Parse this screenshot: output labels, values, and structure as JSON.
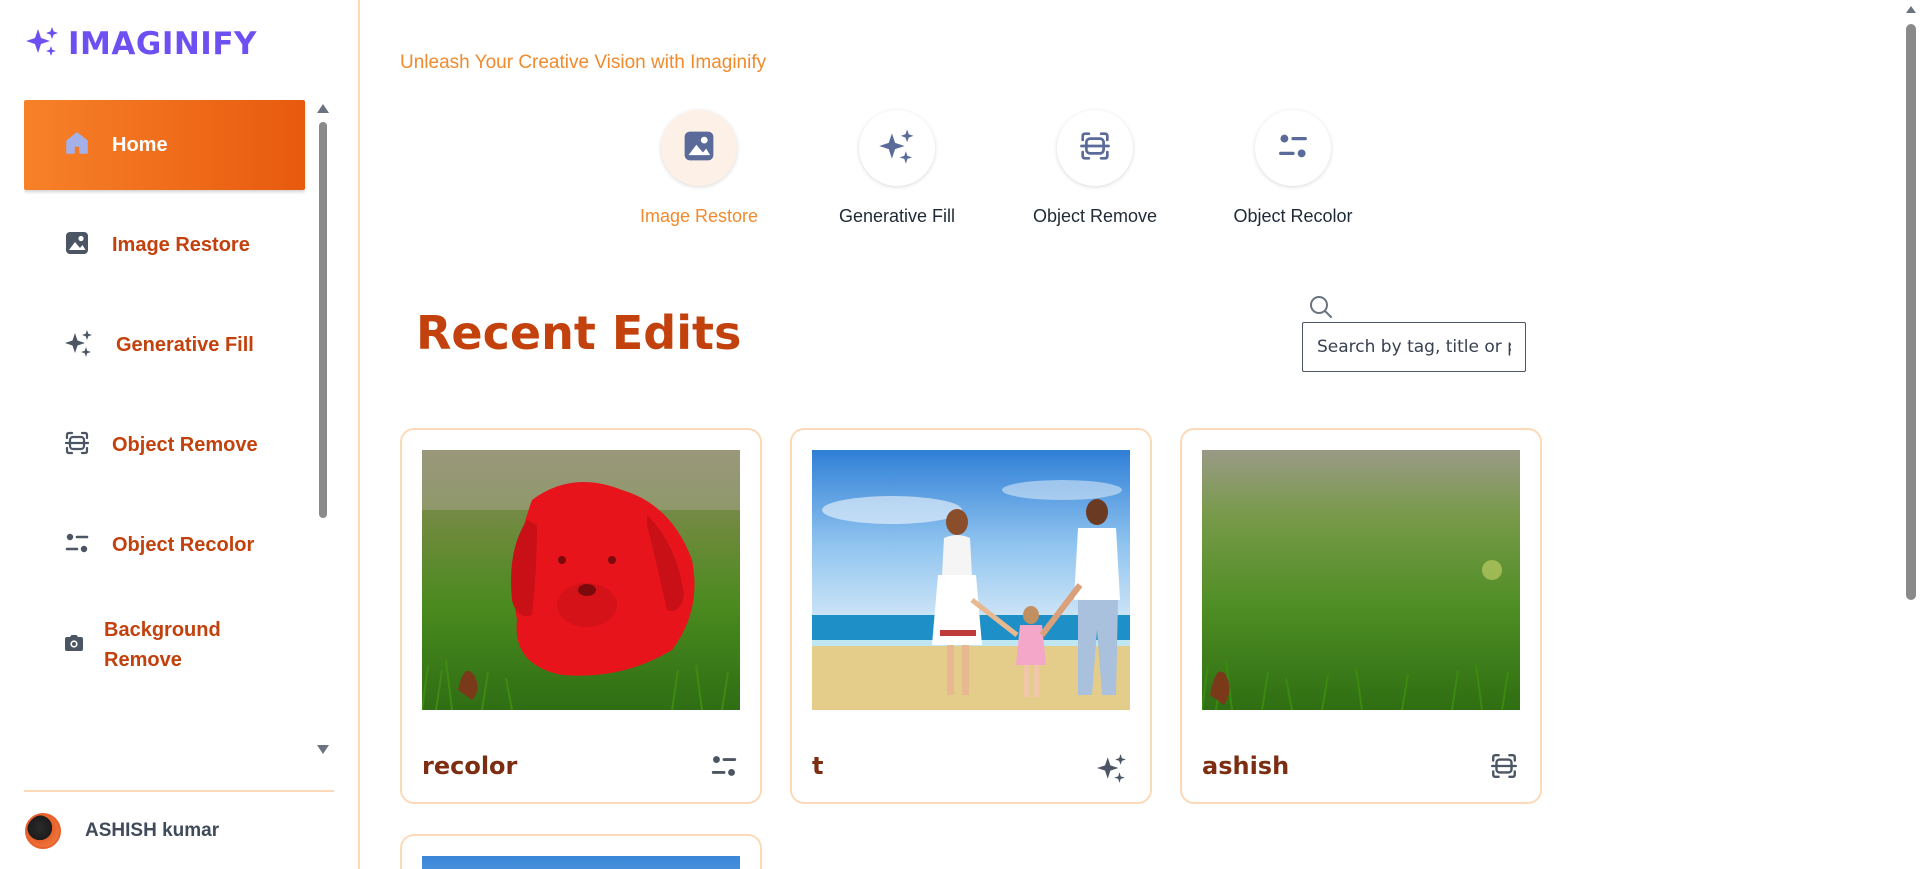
{
  "app": {
    "name": "IMAGINIFY",
    "brand_color": "#6d4ff2",
    "accent_color": "#e8620f"
  },
  "sidebar": {
    "items": [
      {
        "label": "Home",
        "icon": "home-icon",
        "active": true
      },
      {
        "label": "Image Restore",
        "icon": "image-icon",
        "active": false
      },
      {
        "label": "Generative Fill",
        "icon": "sparkles-icon",
        "active": false
      },
      {
        "label": "Object Remove",
        "icon": "scan-icon",
        "active": false
      },
      {
        "label": "Object Recolor",
        "icon": "filter-icon",
        "active": false
      },
      {
        "label": "Background Remove",
        "icon": "camera-icon",
        "active": false
      }
    ],
    "profile": {
      "name": "ASHISH kumar"
    }
  },
  "main": {
    "tagline": "Unleash Your Creative Vision with Imaginify",
    "quick_actions": [
      {
        "label": "Image Restore",
        "icon": "image-icon",
        "active": true
      },
      {
        "label": "Generative Fill",
        "icon": "sparkles-icon",
        "active": false
      },
      {
        "label": "Object Remove",
        "icon": "scan-icon",
        "active": false
      },
      {
        "label": "Object Recolor",
        "icon": "filter-icon",
        "active": false
      }
    ],
    "section_title": "Recent Edits",
    "search": {
      "placeholder": "Search by tag, title or prompt"
    },
    "cards": [
      {
        "title": "recolor",
        "icon": "filter-icon"
      },
      {
        "title": "t",
        "icon": "sparkles-icon"
      },
      {
        "title": "ashish",
        "icon": "scan-icon"
      }
    ]
  }
}
